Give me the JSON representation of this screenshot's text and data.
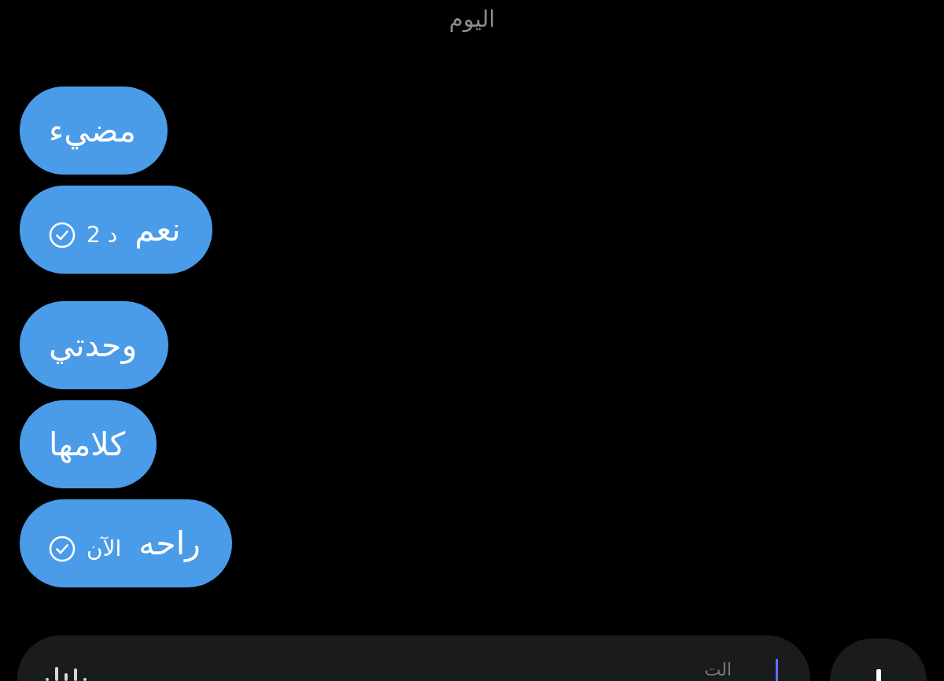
{
  "date_header": "اليوم",
  "groups": [
    {
      "messages": [
        {
          "text": "مضيء"
        },
        {
          "text": "نعم",
          "time": "د 2",
          "read": true
        }
      ]
    },
    {
      "messages": [
        {
          "text": "وحدتي"
        },
        {
          "text": "كلامها"
        },
        {
          "text": "راحه",
          "time": "الآن",
          "read": true
        }
      ]
    }
  ],
  "composer": {
    "placeholder": "الت"
  }
}
